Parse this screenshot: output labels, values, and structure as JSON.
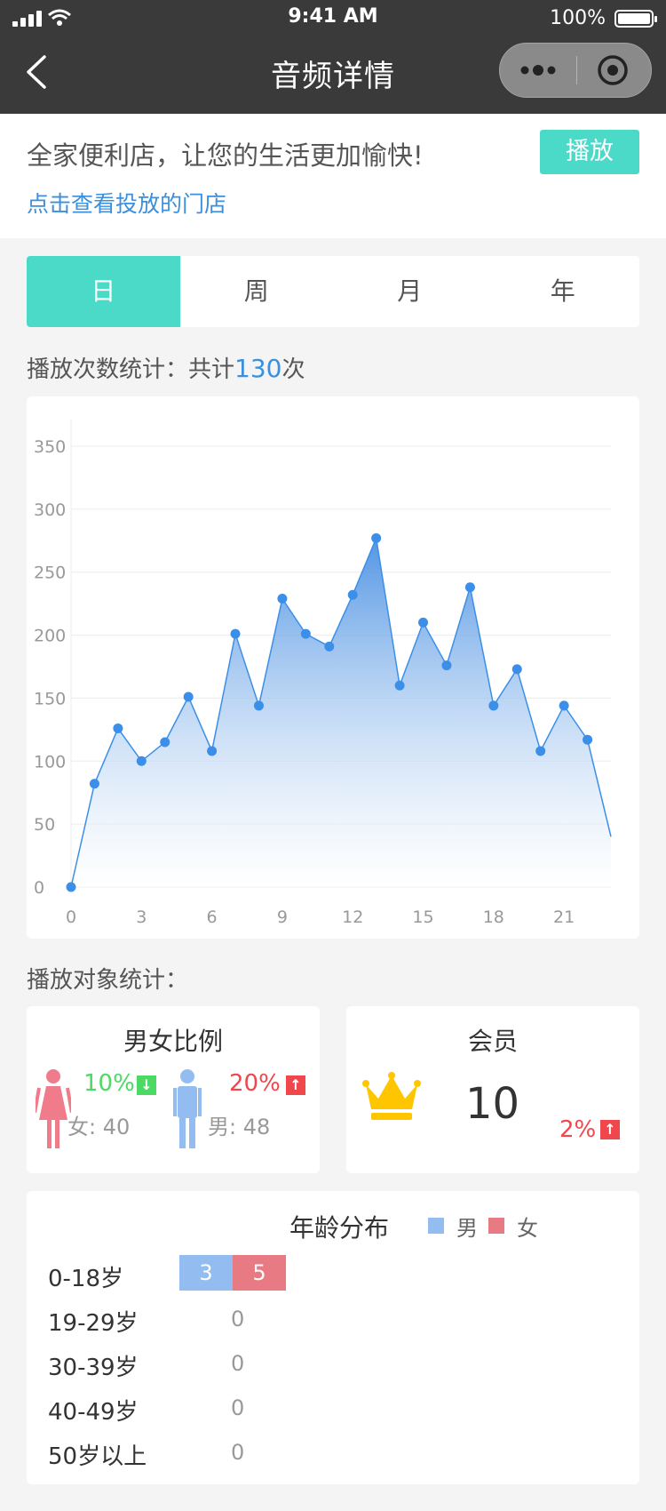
{
  "status": {
    "time": "9:41 AM",
    "battery": "100%"
  },
  "nav": {
    "title": "音频详情"
  },
  "header": {
    "title": "全家便利店，让您的生活更加愉快!",
    "link": "点击查看投放的门店",
    "play_label": "播放"
  },
  "tabs": [
    {
      "label": "日",
      "active": true
    },
    {
      "label": "周",
      "active": false
    },
    {
      "label": "月",
      "active": false
    },
    {
      "label": "年",
      "active": false
    }
  ],
  "play_stats": {
    "label": "播放次数统计：共计",
    "total": "130",
    "unit": "次"
  },
  "chart_data": {
    "type": "area",
    "title": "",
    "xlabel": "",
    "ylabel": "",
    "x": [
      0,
      1,
      2,
      3,
      4,
      5,
      6,
      7,
      8,
      9,
      10,
      11,
      12,
      13,
      14,
      15,
      16,
      17,
      18,
      19,
      20,
      21,
      22
    ],
    "values": [
      0,
      82,
      126,
      100,
      115,
      151,
      108,
      201,
      144,
      229,
      201,
      191,
      232,
      277,
      160,
      210,
      176,
      238,
      144,
      173,
      108,
      144,
      117,
      40
    ],
    "x_ticks": [
      "0",
      "3",
      "6",
      "9",
      "12",
      "15",
      "18",
      "21"
    ],
    "x_tick_values": [
      0,
      3,
      6,
      9,
      12,
      15,
      18,
      21
    ],
    "y_ticks": [
      "0",
      "50",
      "100",
      "150",
      "200",
      "250",
      "300",
      "350"
    ],
    "ylim": [
      0,
      350
    ],
    "grid": true,
    "colors": {
      "line": "#3b8fe8",
      "fill_top": "#4a90e2",
      "fill_bottom": "#ffffff"
    }
  },
  "audience": {
    "label": "播放对象统计：",
    "gender": {
      "title": "男女比例",
      "female": {
        "pct": "10%",
        "trend": "down",
        "count_label": "女: 40"
      },
      "male": {
        "pct": "20%",
        "trend": "up",
        "count_label": "男: 48"
      }
    },
    "member": {
      "title": "会员",
      "count": "10",
      "pct": "2%",
      "trend": "up"
    }
  },
  "age": {
    "title": "年龄分布",
    "legend": [
      {
        "label": "男",
        "color": "#93bdf1"
      },
      {
        "label": "女",
        "color": "#e87a84"
      }
    ],
    "rows": [
      {
        "label": "0-18岁",
        "male": "3",
        "female": "5"
      },
      {
        "label": "19-29岁",
        "zero": "0"
      },
      {
        "label": "30-39岁",
        "zero": "0"
      },
      {
        "label": "40-49岁",
        "zero": "0"
      },
      {
        "label": "50岁以上",
        "zero": "0"
      }
    ]
  },
  "icons": [
    "back-icon",
    "more-icon",
    "close-capsule-icon",
    "signal-icon",
    "wifi-icon",
    "battery-icon",
    "female-icon",
    "male-icon",
    "crown-icon",
    "arrow-down-icon",
    "arrow-up-icon"
  ]
}
